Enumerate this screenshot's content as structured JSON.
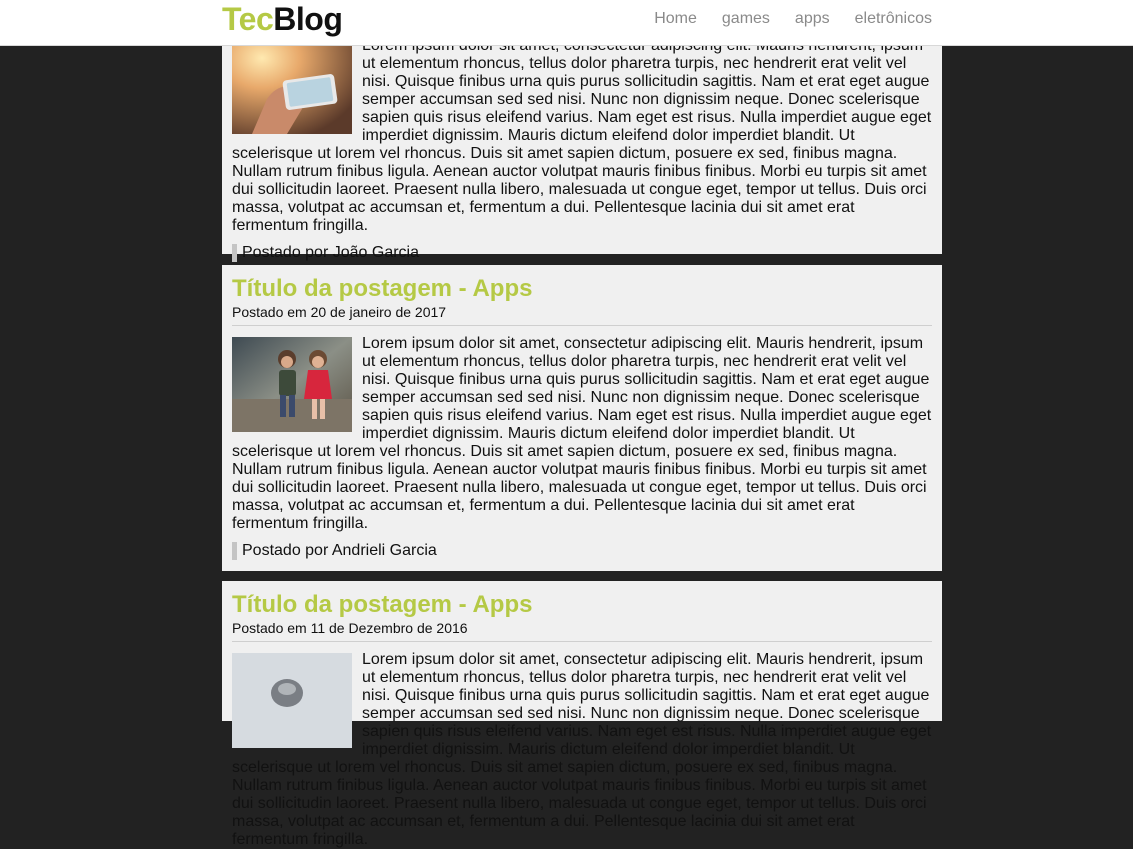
{
  "header": {
    "logo_part1": "Tec",
    "logo_part2": "Blog",
    "nav": [
      "Home",
      "games",
      "apps",
      "eletrônicos"
    ]
  },
  "colors": {
    "accent": "#b5c945",
    "page_background": "#222222",
    "card_background": "#f0f0f0"
  },
  "body_text": "Lorem ipsum dolor sit amet, consectetur adipiscing elit. Mauris hendrerit, ipsum ut elementum rhoncus, tellus dolor pharetra turpis, nec hendrerit erat velit vel nisi. Quisque finibus urna quis purus sollicitudin sagittis. Nam et erat eget augue semper accumsan sed sed nisi. Nunc non dignissim neque. Donec scelerisque sapien quis risus eleifend varius. Nam eget est risus. Nulla imperdiet augue eget imperdiet dignissim. Mauris dictum eleifend dolor imperdiet blandit. Ut scelerisque ut lorem vel rhoncus. Duis sit amet sapien dictum, posuere ex sed, finibus magna. Nullam rutrum finibus ligula. Aenean auctor volutpat mauris finibus finibus. Morbi eu turpis sit amet dui sollicitudin laoreet. Praesent nulla libero, malesuada ut congue eget, tempor ut tellus. Duis orci massa, volutpat ac accumsan et, fermentum a dui. Pellentesque lacinia dui sit amet erat fermentum fringilla.",
  "posts": [
    {
      "title": "",
      "date": "",
      "author": "Postado por João Garcia",
      "image": "phone-photo"
    },
    {
      "title": "Título da postagem - Apps",
      "date": "Postado em 20 de janeiro de 2017",
      "author": "Postado por Andrieli Garcia",
      "image": "two-children-photo"
    },
    {
      "title": "Título da postagem - Apps",
      "date": "Postado em 11 de Dezembro de 2016",
      "author": "",
      "image": "bird-photo"
    }
  ]
}
